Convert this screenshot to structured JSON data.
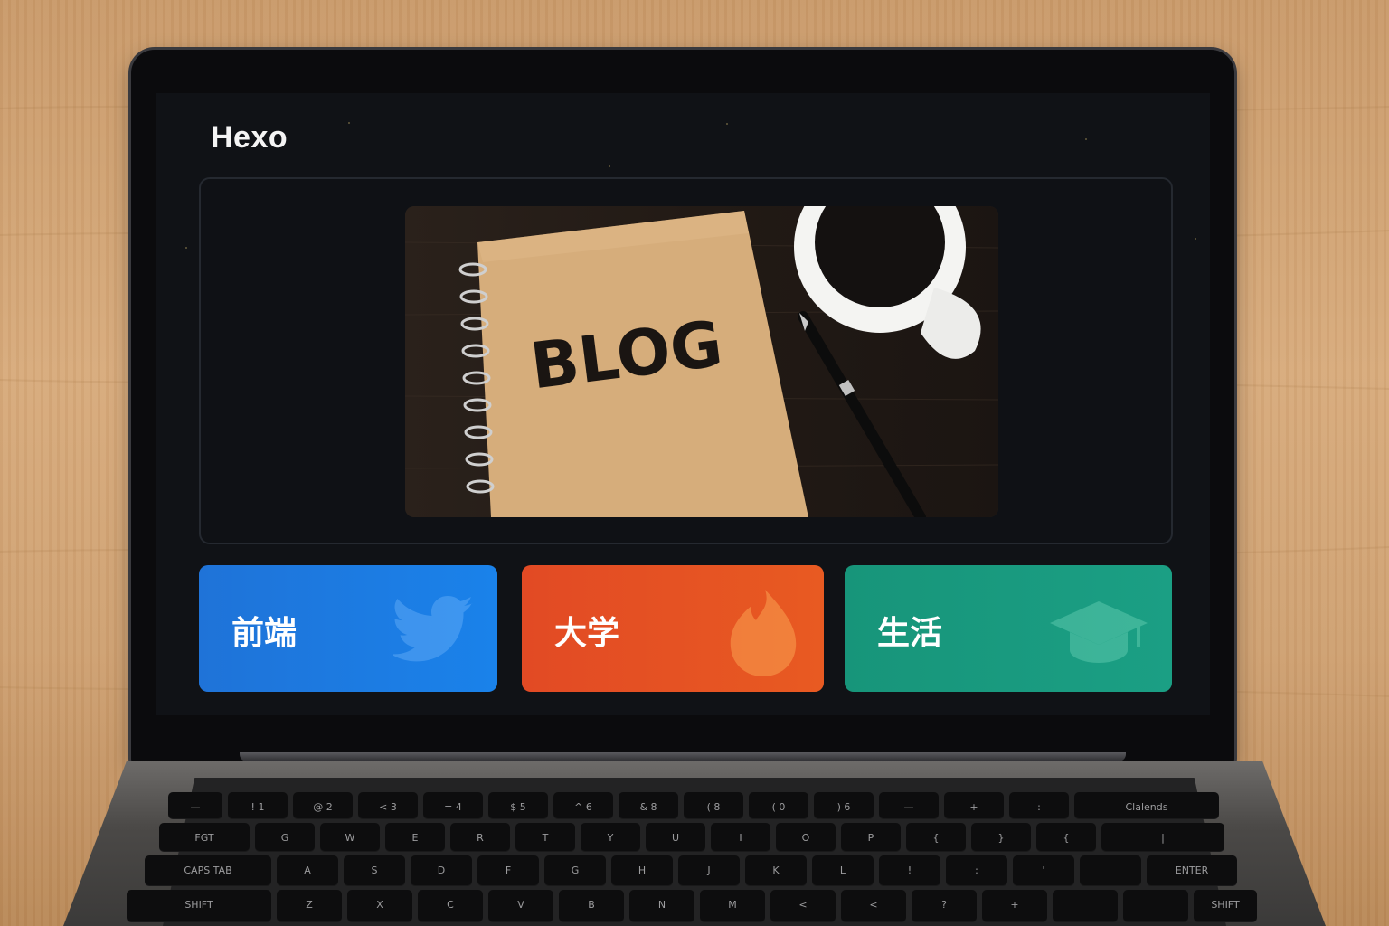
{
  "site": {
    "title": "Hexo"
  },
  "hero": {
    "image_label": "BLOG"
  },
  "categories": [
    {
      "label": "前端",
      "icon": "twitter-bird-icon",
      "color": "#1f73d8"
    },
    {
      "label": "大学",
      "icon": "fire-icon",
      "color": "#e24a24"
    },
    {
      "label": "生活",
      "icon": "graduation-cap-icon",
      "color": "#17957a"
    }
  ],
  "keyboard": {
    "row1": [
      "—",
      "!\n1",
      "@\n2",
      "<\n3",
      "=\n4",
      "$\n5",
      "^\n6",
      "&\n8",
      "(\n8",
      "(\n0",
      ")\n6",
      "—",
      "+",
      ":",
      "+"
    ],
    "row2": [
      "FGT",
      "G",
      "W",
      "E",
      "R",
      "T",
      "Y",
      "U",
      "I",
      "O",
      "P",
      "{",
      "}",
      "{",
      "|"
    ],
    "row3": [
      "CAPS TAB",
      "A",
      "S",
      "D",
      "F",
      "G",
      "H",
      "J",
      "K",
      "L",
      "!",
      ":",
      "'",
      "",
      "ENTER"
    ],
    "row4": [
      "SHIFT",
      "Z",
      "X",
      "C",
      "V",
      "B",
      "N",
      "M",
      "<",
      "<",
      "?",
      "+",
      "",
      "",
      "SHIFT"
    ],
    "side_right": "Clalends"
  }
}
